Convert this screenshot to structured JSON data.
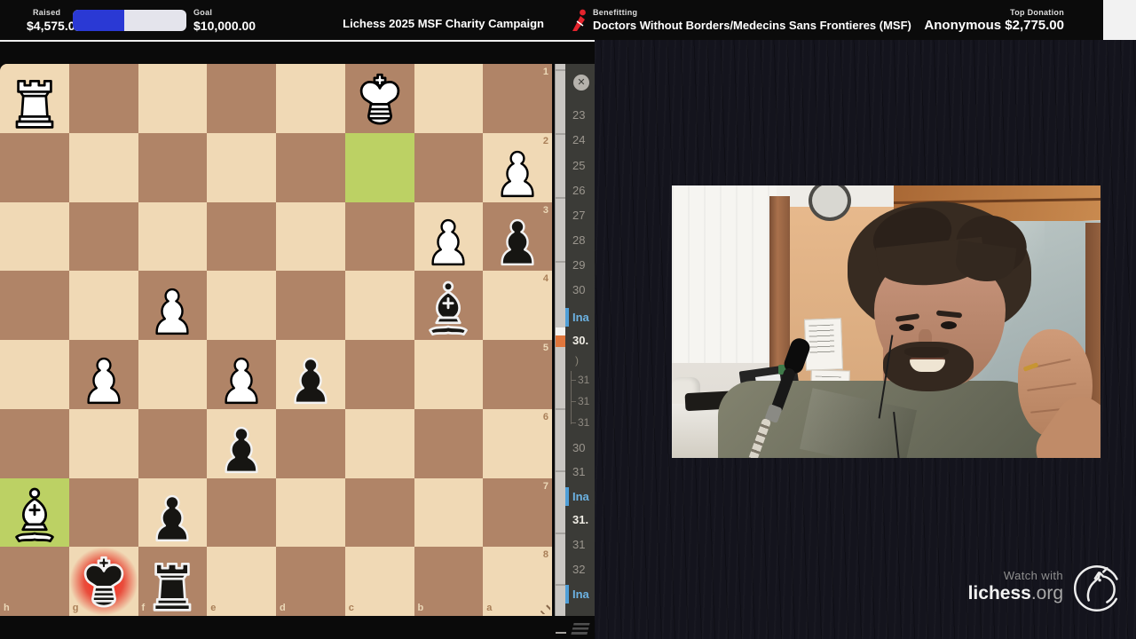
{
  "banner": {
    "raised_label": "Raised",
    "raised_value": "$4,575.00",
    "goal_label": "Goal",
    "goal_value": "$10,000.00",
    "progress_percent": 45,
    "title": "Lichess 2025 MSF Charity Campaign",
    "benefitting_label": "Benefitting",
    "benefitting_value": "Doctors Without Borders/Medecins Sans Frontieres (MSF)",
    "top_donation_label": "Top Donation",
    "top_donation_value": "Anonymous $2,775.00"
  },
  "board": {
    "orientation": "black",
    "files_left_to_right": [
      "h",
      "g",
      "f",
      "e",
      "d",
      "c",
      "b",
      "a"
    ],
    "ranks_top_to_bottom": [
      "1",
      "2",
      "3",
      "4",
      "5",
      "6",
      "7",
      "8"
    ],
    "last_move_highlight": [
      "c2",
      "h7"
    ],
    "check_square": "g8",
    "pieces": [
      {
        "square": "h1",
        "color": "white",
        "type": "rook"
      },
      {
        "square": "c1",
        "color": "white",
        "type": "king"
      },
      {
        "square": "a2",
        "color": "white",
        "type": "pawn"
      },
      {
        "square": "b3",
        "color": "white",
        "type": "pawn"
      },
      {
        "square": "a3",
        "color": "black",
        "type": "pawn"
      },
      {
        "square": "f4",
        "color": "white",
        "type": "pawn"
      },
      {
        "square": "b4",
        "color": "black",
        "type": "bishop"
      },
      {
        "square": "g5",
        "color": "white",
        "type": "pawn"
      },
      {
        "square": "e5",
        "color": "white",
        "type": "pawn"
      },
      {
        "square": "d5",
        "color": "black",
        "type": "pawn"
      },
      {
        "square": "e6",
        "color": "black",
        "type": "pawn"
      },
      {
        "square": "h7",
        "color": "white",
        "type": "bishop"
      },
      {
        "square": "f7",
        "color": "black",
        "type": "pawn"
      },
      {
        "square": "g8",
        "color": "black",
        "type": "king"
      },
      {
        "square": "f8",
        "color": "black",
        "type": "rook"
      }
    ]
  },
  "movelist": {
    "close_glyph": "✕",
    "rows": [
      {
        "text": "23",
        "type": "num"
      },
      {
        "text": "24",
        "type": "num"
      },
      {
        "text": "25",
        "type": "num"
      },
      {
        "text": "26",
        "type": "num"
      },
      {
        "text": "27",
        "type": "num"
      },
      {
        "text": "28",
        "type": "num"
      },
      {
        "text": "29",
        "type": "num"
      },
      {
        "text": "30",
        "type": "num"
      },
      {
        "text": "Ina",
        "type": "badge"
      },
      {
        "text": "30.",
        "type": "current"
      },
      {
        "text": ")",
        "type": "paren"
      },
      {
        "text": "31",
        "type": "var"
      },
      {
        "text": "31",
        "type": "var"
      },
      {
        "text": "31",
        "type": "var"
      },
      {
        "text": "30",
        "type": "num"
      },
      {
        "text": "31",
        "type": "num"
      },
      {
        "text": "Ina",
        "type": "badge"
      },
      {
        "text": "31.",
        "type": "current"
      },
      {
        "text": "31",
        "type": "num"
      },
      {
        "text": "32",
        "type": "num"
      },
      {
        "text": "Ina",
        "type": "badge"
      }
    ]
  },
  "watermark": {
    "prefix": "Watch with",
    "brand": "lichess",
    "suffix": ".org"
  },
  "webcam": {
    "description": "Streamer with dark hair and beard smiling at camera, hand raised to earbud, white room with wooden wardrobe, clock, papers on wall, desk and microphone arm"
  },
  "colors": {
    "banner_bg": "#0b0b0b",
    "progress_blue": "#2a39d4",
    "progress_track": "#e4e4ec",
    "msf_red": "#e5242d",
    "board_light": "#f0d9b5",
    "board_dark": "#b08467",
    "highlight_green": "#bcd164",
    "check_red": "#e32b20",
    "panel_bg": "#3b3b37",
    "badge_blue": "#6cb2e2",
    "right_bg": "#14141d"
  }
}
